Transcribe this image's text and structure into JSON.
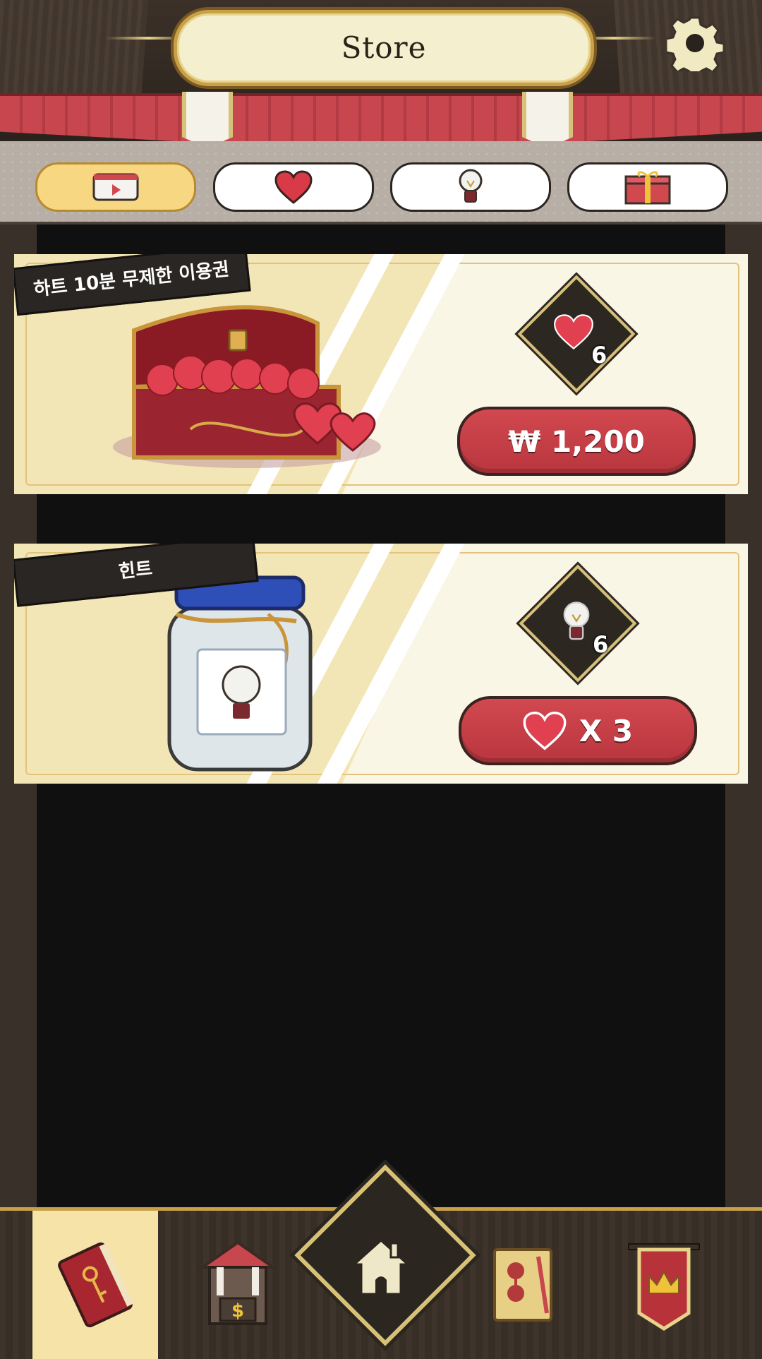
{
  "header": {
    "title": "Store"
  },
  "tabs": [
    {
      "icon": "video-ad-icon",
      "active": true
    },
    {
      "icon": "heart-icon",
      "active": false
    },
    {
      "icon": "lightbulb-icon",
      "active": false
    },
    {
      "icon": "gift-box-icon",
      "active": false
    }
  ],
  "products": [
    {
      "banner": "하트 10분 무제한 이용권",
      "image": "treasure-chest-of-hearts",
      "reward_icon": "heart-icon",
      "reward_count": "6",
      "price_label": "₩ 1,200"
    },
    {
      "banner": "힌트",
      "image": "jar-of-lightbulbs",
      "reward_icon": "lightbulb-icon",
      "reward_count": "6",
      "price_label": "X 3",
      "price_icon": "heart-icon"
    }
  ],
  "bottom_nav": [
    {
      "icon": "book-key-icon",
      "active": true
    },
    {
      "icon": "shop-stall-icon",
      "active": false
    },
    {
      "icon": "home-icon",
      "active": false
    },
    {
      "icon": "letter-envelope-icon",
      "active": false
    },
    {
      "icon": "crown-banner-icon",
      "active": false
    }
  ],
  "colors": {
    "accent_red": "#c8464e",
    "tab_active": "#f8d782",
    "gold": "#d6c07a"
  }
}
